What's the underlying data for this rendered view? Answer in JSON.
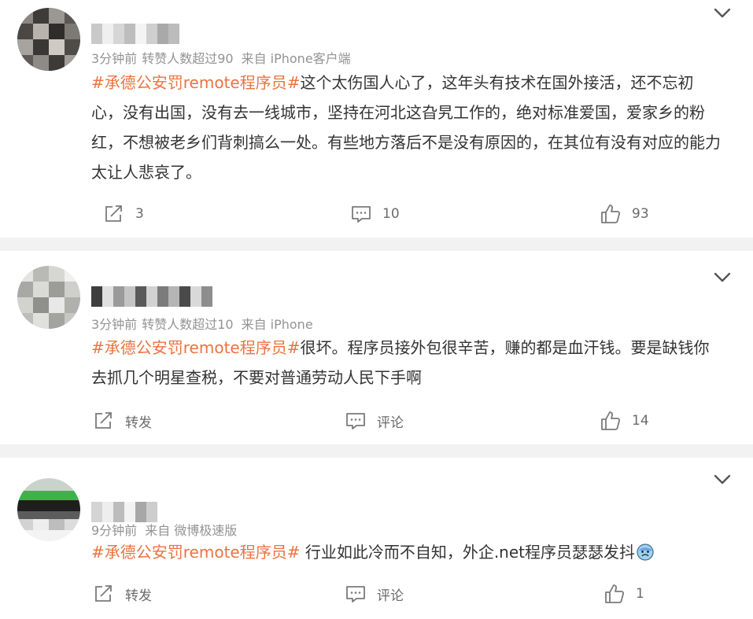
{
  "colors": {
    "topic": "#eb7340",
    "text": "#333333",
    "meta": "#939393",
    "background": "#f2f2f2",
    "card": "#ffffff"
  },
  "icons": {
    "chevron": "chevron-down-icon",
    "repost": "repost-icon",
    "comment": "comment-icon",
    "like": "thumbs-up-icon",
    "emoji": "cold-sweat-emoji"
  },
  "posts": [
    {
      "meta": {
        "time": "3分钟前",
        "reposts_note": "转赞人数超过90",
        "source": "来自 iPhone客户端"
      },
      "topic": "#承德公安罚remote程序员#",
      "text": "这个太伤国人心了，这年头有技术在国外接活，还不忘初心，没有出国，没有去一线城市，坚持在河北这旮旯工作的，绝对标准爱国，爱家乡的粉红，不想被老乡们背刺搞么一处。有些地方落后不是没有原因的，在其位有没有对应的能力太让人悲哀了。",
      "actions": {
        "repost": "3",
        "comment": "10",
        "like": "93"
      }
    },
    {
      "meta": {
        "time": "3分钟前",
        "reposts_note": "转赞人数超过10",
        "source": "来自 iPhone"
      },
      "topic": "#承德公安罚remote程序员#",
      "text": "很坏。程序员接外包很辛苦，赚的都是血汗钱。要是缺钱你去抓几个明星查税，不要对普通劳动人民下手啊",
      "actions": {
        "repost": "转发",
        "comment": "评论",
        "like": "14"
      }
    },
    {
      "meta": {
        "time": "9分钟前",
        "reposts_note": "",
        "source": "来自 微博极速版"
      },
      "topic": "#承德公安罚remote程序员#",
      "text": " 行业如此冷而不自知，外企.net程序员瑟瑟发抖",
      "actions": {
        "repost": "转发",
        "comment": "评论",
        "like": "1"
      }
    }
  ]
}
